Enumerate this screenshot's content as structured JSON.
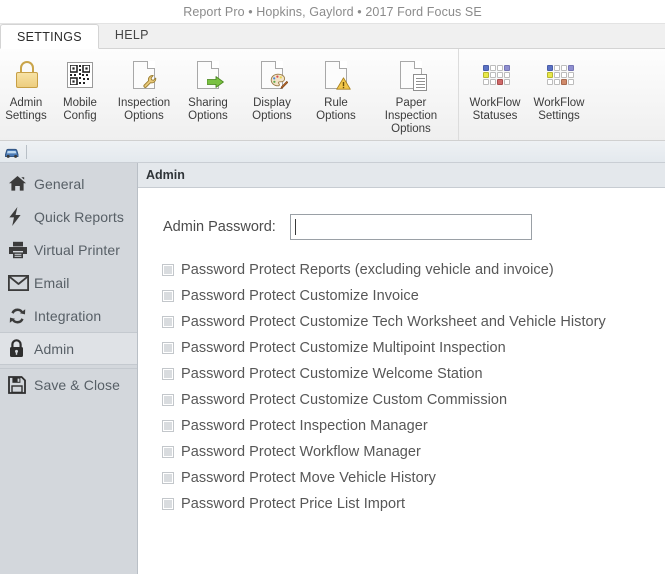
{
  "window": {
    "title": "Report Pro • Hopkins, Gaylord • 2017 Ford Focus SE"
  },
  "tabs": [
    {
      "label": "SETTINGS",
      "active": true
    },
    {
      "label": "HELP",
      "active": false
    }
  ],
  "ribbon": {
    "groups": [
      {
        "name": "settings-group",
        "items": [
          {
            "label": "Admin\nSettings",
            "icon": "padlock-icon"
          },
          {
            "label": "Mobile\nConfig",
            "icon": "qr-code-icon"
          },
          {
            "label": "Inspection\nOptions",
            "icon": "document-wrench-icon"
          },
          {
            "label": "Sharing\nOptions",
            "icon": "document-arrow-icon"
          },
          {
            "label": "Display\nOptions",
            "icon": "document-palette-icon"
          },
          {
            "label": "Rule\nOptions",
            "icon": "document-warning-icon"
          },
          {
            "label": "Paper Inspection\nOptions",
            "icon": "document-page-icon"
          }
        ]
      },
      {
        "name": "workflow-group",
        "items": [
          {
            "label": "WorkFlow\nStatuses",
            "icon": "workflow-grid-icon"
          },
          {
            "label": "WorkFlow\nSettings",
            "icon": "workflow-grid-icon"
          }
        ]
      }
    ]
  },
  "quick_access": {
    "buttons": [
      {
        "name": "vehicle-icon",
        "label": ""
      }
    ]
  },
  "sidebar": {
    "items": [
      {
        "label": "General",
        "icon": "home-icon",
        "selected": false
      },
      {
        "label": "Quick Reports",
        "icon": "lightning-icon",
        "selected": false
      },
      {
        "label": "Virtual Printer",
        "icon": "printer-icon",
        "selected": false
      },
      {
        "label": "Email",
        "icon": "envelope-icon",
        "selected": false
      },
      {
        "label": "Integration",
        "icon": "sync-icon",
        "selected": false
      },
      {
        "label": "Admin",
        "icon": "lock-icon",
        "selected": true
      },
      {
        "label": "Save & Close",
        "icon": "floppy-disk-icon",
        "selected": false
      }
    ]
  },
  "content": {
    "section_title": "Admin",
    "password_label": "Admin Password:",
    "password_value": "",
    "password_placeholder": "",
    "checkboxes": [
      {
        "label": "Password Protect Reports (excluding vehicle and invoice)",
        "checked": false
      },
      {
        "label": "Password Protect Customize Invoice",
        "checked": false
      },
      {
        "label": "Password Protect Customize Tech Worksheet and Vehicle History",
        "checked": false
      },
      {
        "label": "Password Protect Customize Multipoint Inspection",
        "checked": false
      },
      {
        "label": "Password Protect Customize Welcome Station",
        "checked": false
      },
      {
        "label": "Password Protect Customize Custom Commission",
        "checked": false
      },
      {
        "label": "Password Protect Inspection Manager",
        "checked": false
      },
      {
        "label": "Password Protect Workflow Manager",
        "checked": false
      },
      {
        "label": "Password Protect Move Vehicle History",
        "checked": false
      },
      {
        "label": "Password Protect Price List Import",
        "checked": false
      }
    ]
  },
  "colors": {
    "sidebar_bg": "#d3d7dc",
    "section_head_bg": "#e4e8ec",
    "accent_amber": "#edcd7e",
    "workflow_blue": "#5b72c4",
    "workflow_purple": "#8f8fd0",
    "workflow_yellow": "#e8e84a",
    "workflow_red": "#d06a6a"
  }
}
